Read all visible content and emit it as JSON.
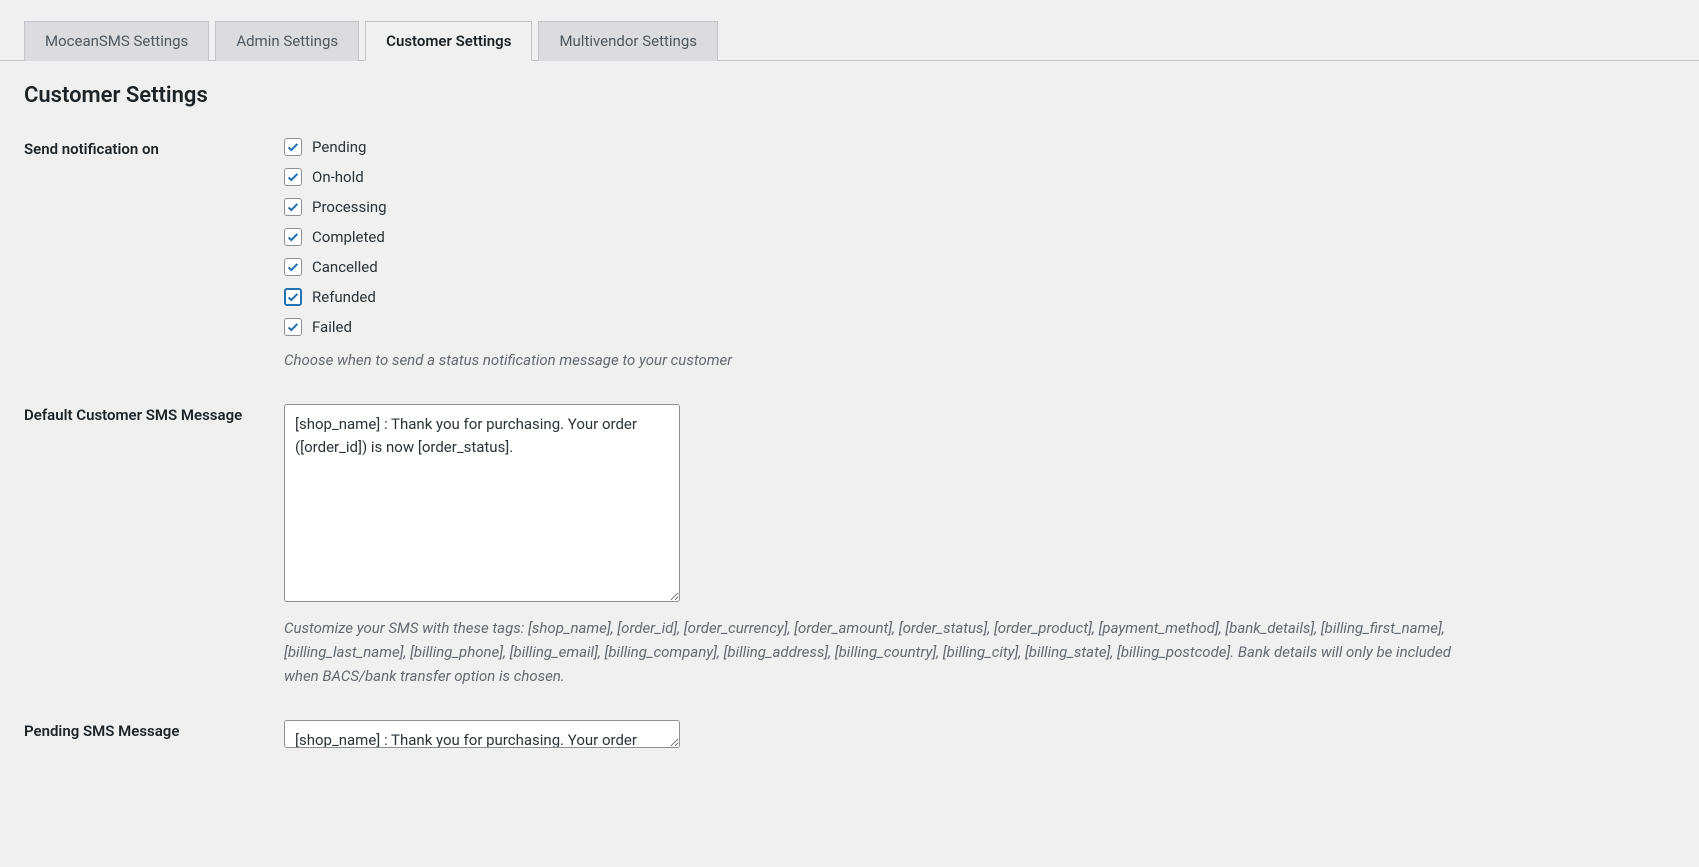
{
  "tabs": [
    {
      "label": "MoceanSMS Settings",
      "active": false
    },
    {
      "label": "Admin Settings",
      "active": false
    },
    {
      "label": "Customer Settings",
      "active": true
    },
    {
      "label": "Multivendor Settings",
      "active": false
    }
  ],
  "heading": "Customer Settings",
  "send_notification": {
    "label": "Send notification on",
    "options": [
      {
        "label": "Pending",
        "checked": true,
        "focused": false
      },
      {
        "label": "On-hold",
        "checked": true,
        "focused": false
      },
      {
        "label": "Processing",
        "checked": true,
        "focused": false
      },
      {
        "label": "Completed",
        "checked": true,
        "focused": false
      },
      {
        "label": "Cancelled",
        "checked": true,
        "focused": false
      },
      {
        "label": "Refunded",
        "checked": true,
        "focused": true
      },
      {
        "label": "Failed",
        "checked": true,
        "focused": false
      }
    ],
    "description": "Choose when to send a status notification message to your customer"
  },
  "default_message": {
    "label": "Default Customer SMS Message",
    "value": "[shop_name] : Thank you for purchasing. Your order ([order_id]) is now [order_status].",
    "description": "Customize your SMS with these tags: [shop_name], [order_id], [order_currency], [order_amount], [order_status], [order_product], [payment_method], [bank_details], [billing_first_name], [billing_last_name], [billing_phone], [billing_email], [billing_company], [billing_address], [billing_country], [billing_city], [billing_state], [billing_postcode]. Bank details will only be included when BACS/bank transfer option is chosen."
  },
  "pending_message": {
    "label": "Pending SMS Message",
    "value": "[shop_name] : Thank you for purchasing. Your order"
  }
}
